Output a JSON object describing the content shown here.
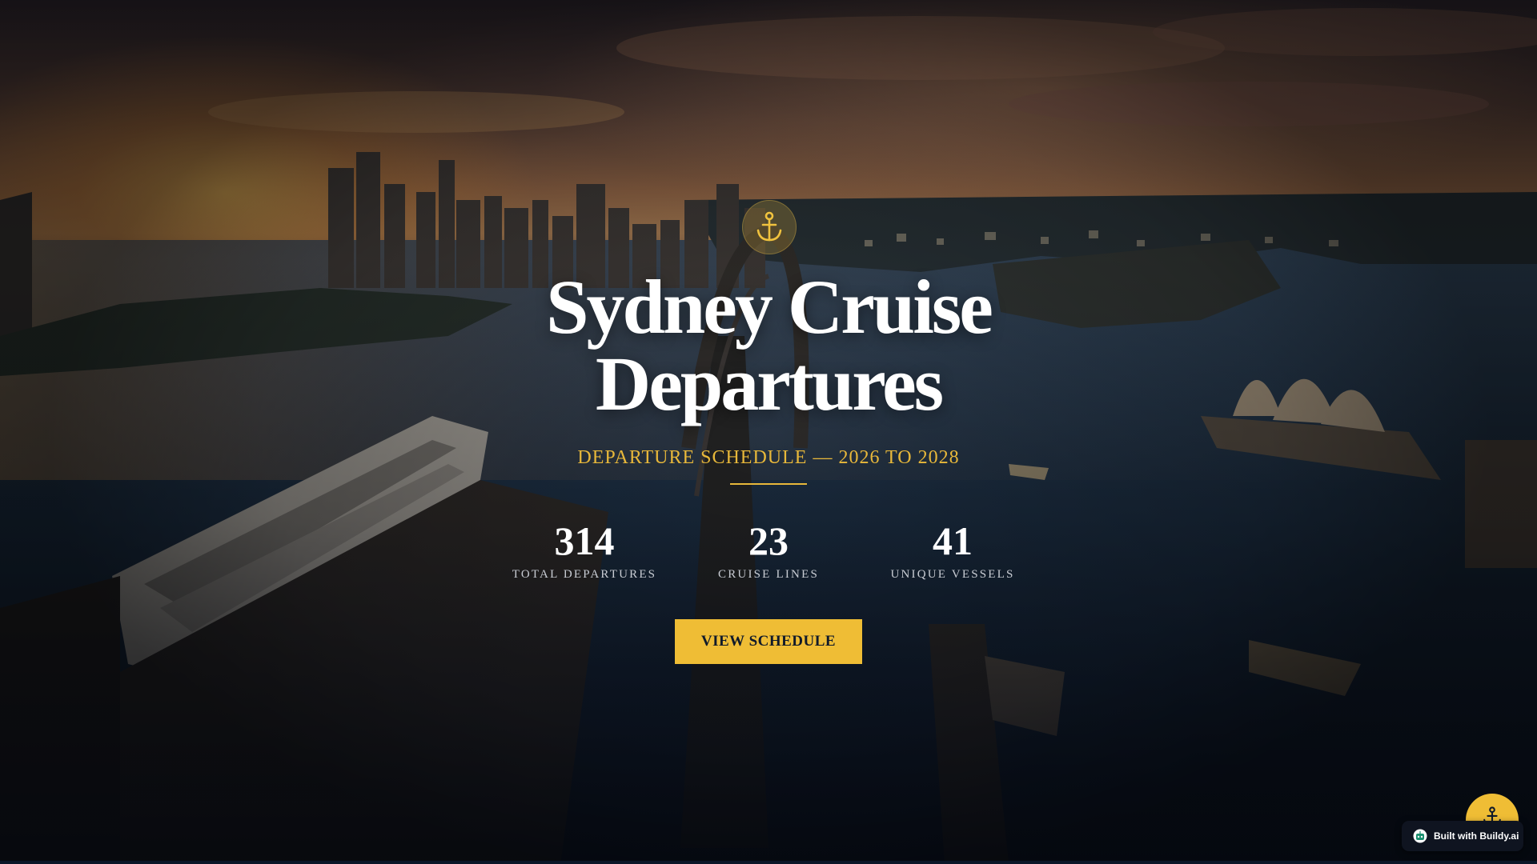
{
  "hero": {
    "icon": "anchor-icon",
    "title": "Sydney Cruise Departures",
    "subtitle": "DEPARTURE SCHEDULE — 2026 TO 2028",
    "stats": [
      {
        "value": "314",
        "label": "TOTAL DEPARTURES"
      },
      {
        "value": "23",
        "label": "CRUISE LINES"
      },
      {
        "value": "41",
        "label": "UNIQUE VESSELS"
      }
    ],
    "cta_label": "VIEW SCHEDULE"
  },
  "floating": {
    "fab_icon": "anchor-icon",
    "badge_icon": "robot-icon",
    "badge_label": "Built with Buildy.ai"
  },
  "colors": {
    "accent": "#efbd35",
    "subtitle": "#e8b83a",
    "dark": "#0f1420"
  }
}
